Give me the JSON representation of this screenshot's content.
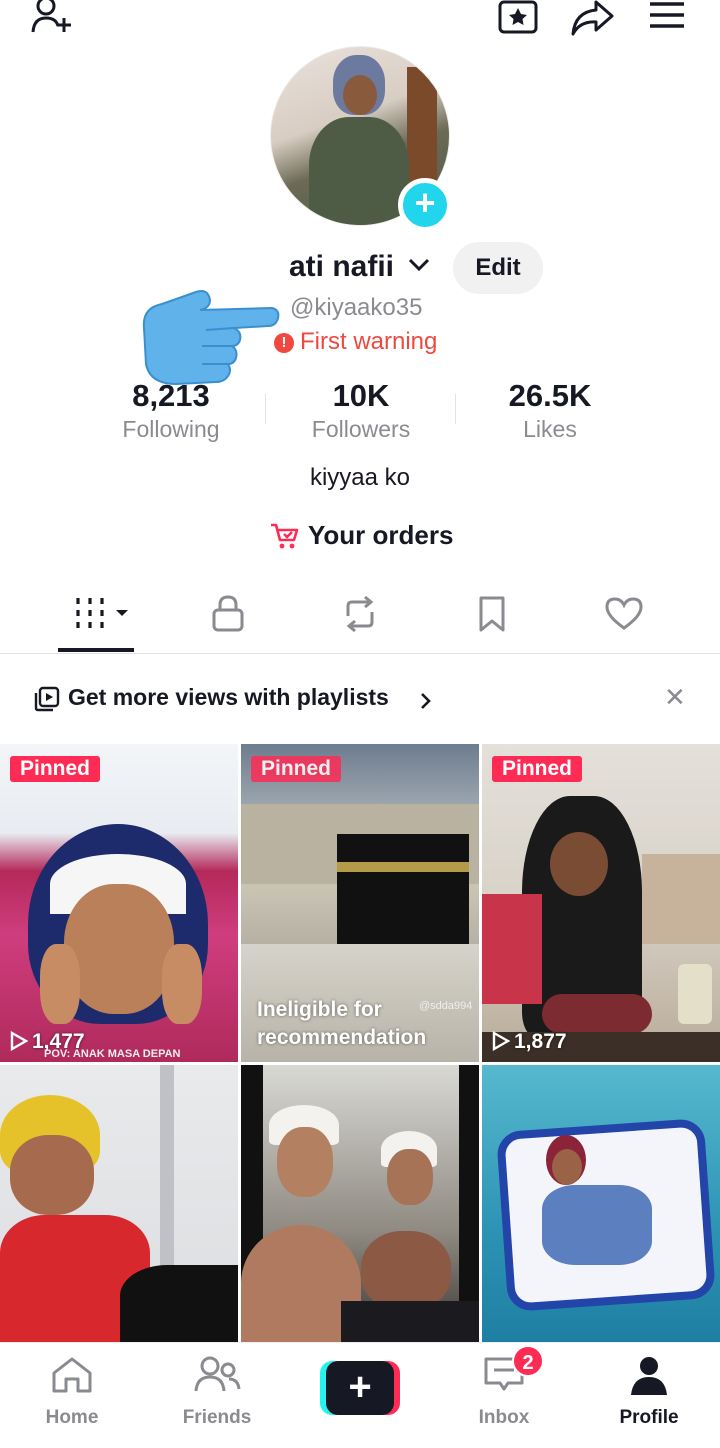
{
  "profile": {
    "display_name": "ati nafii",
    "handle": "@kiyaako35",
    "warning": "First warning",
    "edit_label": "Edit",
    "bio": "kiyyaa ko",
    "orders_label": "Your orders"
  },
  "stats": [
    {
      "value": "8,213",
      "label": "Following"
    },
    {
      "value": "10K",
      "label": "Followers"
    },
    {
      "value": "26.5K",
      "label": "Likes"
    }
  ],
  "playlist_prompt": "Get more views with playlists",
  "videos": [
    {
      "pinned": "Pinned",
      "views": "1,477",
      "overlay": "POV: ANAK MASA DEPAN"
    },
    {
      "pinned": "Pinned",
      "notice": "Ineligible for recommendation",
      "watermark": "@sdda994"
    },
    {
      "pinned": "Pinned",
      "views": "1,877"
    }
  ],
  "nav": {
    "home": "Home",
    "friends": "Friends",
    "inbox": "Inbox",
    "inbox_badge": "2",
    "profile": "Profile"
  },
  "colors": {
    "accent": "#fe2c55",
    "cyan": "#25f4ee",
    "warning": "#f0483e"
  }
}
